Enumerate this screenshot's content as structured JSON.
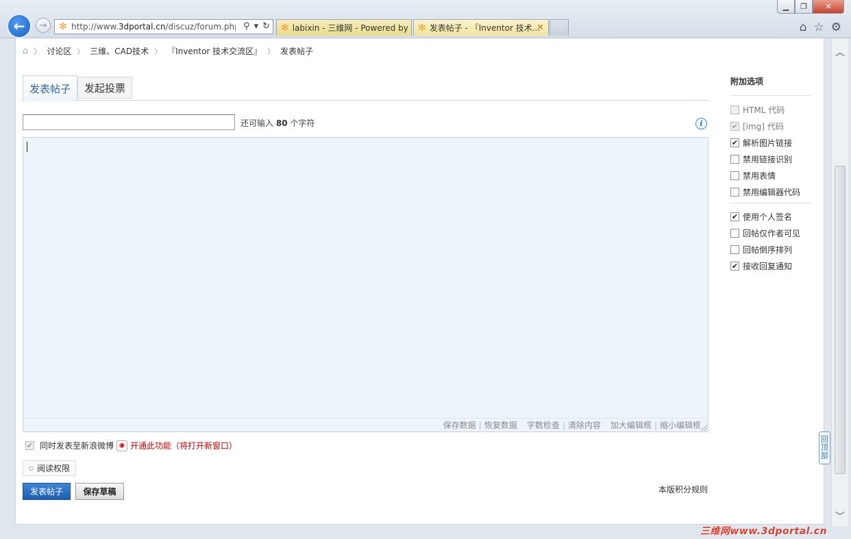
{
  "browser": {
    "url_prefix": "http://www.",
    "url_host": "3dportal.cn",
    "url_path": "/discuz/forum.php?m",
    "tabs": [
      {
        "label": "labixin - 三维网 - Powered by ..."
      },
      {
        "label": "发表帖子 - 『Inventor 技术..."
      }
    ],
    "icons": {
      "back": "back-arrow-icon",
      "forward": "forward-arrow-icon",
      "search": "search-icon",
      "refresh": "refresh-icon",
      "home": "home-icon",
      "favorites": "star-icon",
      "tools": "gear-icon"
    }
  },
  "breadcrumb": {
    "items": [
      "讨论区",
      "三维、CAD技术",
      "『Inventor 技术交流区』",
      "发表帖子"
    ]
  },
  "post_tabs": {
    "post": "发表帖子",
    "vote": "发起投票"
  },
  "title_field": {
    "value": "",
    "count_prefix": "还可输入",
    "count_value": "80",
    "count_suffix": "个字符"
  },
  "editor": {
    "actions": [
      "保存数据",
      "恢复数据",
      "字数检查",
      "清除内容",
      "加大编辑框",
      "缩小编辑框"
    ]
  },
  "weibo": {
    "label": "同时发表至新浪微博",
    "link": "开通此功能（将打开新窗口）",
    "checked": true
  },
  "permission": {
    "label": "阅读权限"
  },
  "buttons": {
    "post": "发表帖子",
    "draft": "保存草稿"
  },
  "rules_link": "本版积分规则",
  "sidebar": {
    "title": "附加选项",
    "group1": [
      {
        "label": "HTML 代码",
        "checked": false,
        "disabled": true
      },
      {
        "label": "[img] 代码",
        "checked": true,
        "disabled": true
      },
      {
        "label": "解析图片链接",
        "checked": true,
        "disabled": false
      },
      {
        "label": "禁用链接识别",
        "checked": false,
        "disabled": false
      },
      {
        "label": "禁用表情",
        "checked": false,
        "disabled": false
      },
      {
        "label": "禁用编辑器代码",
        "checked": false,
        "disabled": false
      }
    ],
    "group2": [
      {
        "label": "使用个人签名",
        "checked": true
      },
      {
        "label": "回帖仅作者可见",
        "checked": false
      },
      {
        "label": "回帖倒序排列",
        "checked": false
      },
      {
        "label": "接收回复通知",
        "checked": true
      }
    ]
  },
  "backtop": [
    "回",
    "顶",
    "部"
  ],
  "watermark": "三维网www.3dportal.cn"
}
